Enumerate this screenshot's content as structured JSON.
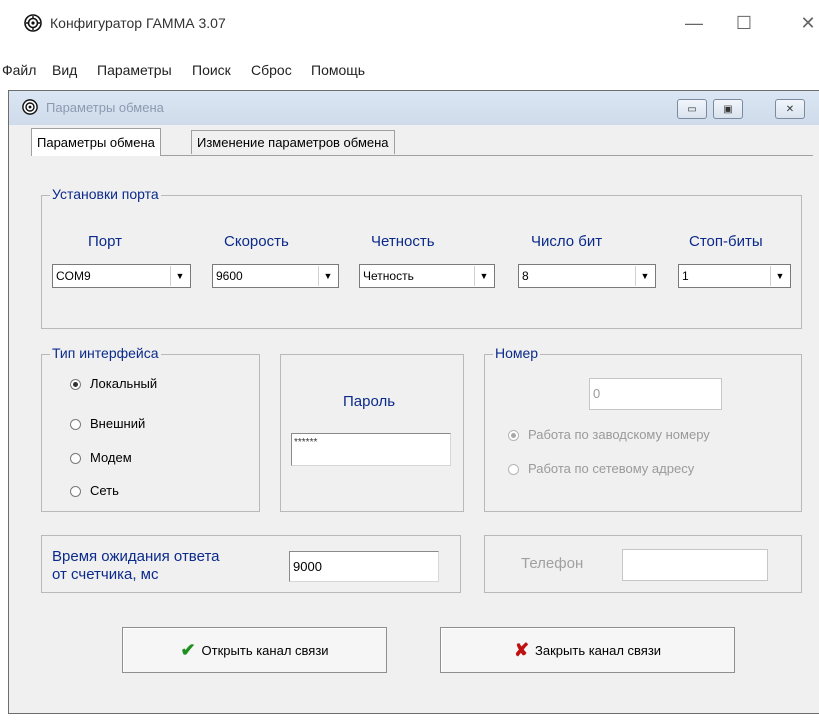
{
  "app": {
    "title": "Конфигуратор ГАММА 3.07",
    "minimize": "—",
    "maximize": "☐",
    "close": "✕"
  },
  "menu": [
    "Файл",
    "Вид",
    "Параметры",
    "Поиск",
    "Сброс",
    "Помощь"
  ],
  "child_window": {
    "title": "Параметры обмена",
    "min_glyph": "▭",
    "restore_glyph": "▣",
    "close_glyph": "✕"
  },
  "tabs": [
    "Параметры обмена",
    "Изменение параметров обмена"
  ],
  "port_settings": {
    "title": "Установки порта",
    "columns": [
      {
        "label": "Порт",
        "value": "COM9"
      },
      {
        "label": "Скорость",
        "value": "9600"
      },
      {
        "label": "Четность",
        "value": "Четность"
      },
      {
        "label": "Число бит",
        "value": "8"
      },
      {
        "label": "Стоп-биты",
        "value": "1"
      }
    ]
  },
  "interface": {
    "title": "Тип интерфейса",
    "options": [
      "Локальный",
      "Внешний",
      "Модем",
      "Сеть"
    ],
    "selected_index": 0
  },
  "password": {
    "label": "Пароль",
    "value": "******"
  },
  "number": {
    "title": "Номер",
    "value": "0",
    "options": [
      "Работа по заводскому номеру",
      "Работа по сетевому адресу"
    ],
    "selected_index": 0
  },
  "timeout": {
    "label_line1": "Время ожидания ответа",
    "label_line2": "от счетчика, мс",
    "value": "9000"
  },
  "phone": {
    "label": "Телефон",
    "value": ""
  },
  "buttons": {
    "open": "Открыть канал связи",
    "close": "Закрыть канал связи"
  },
  "colors": {
    "label_blue": "#0b2a8a",
    "check_green": "#1f8f1f",
    "cross_red": "#c01010"
  }
}
